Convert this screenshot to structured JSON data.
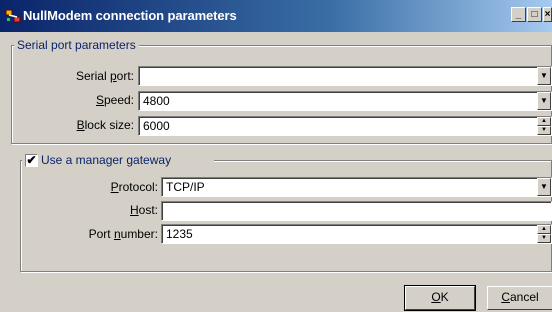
{
  "window": {
    "title": "NullModem connection parameters",
    "controls": {
      "minimize": "_",
      "maximize": "□",
      "close": "×"
    }
  },
  "serial_group": {
    "legend": "Serial port parameters",
    "serial_port": {
      "label_prefix": "Serial ",
      "label_accel": "p",
      "label_suffix": "ort:",
      "value": ""
    },
    "speed": {
      "label_prefix": "",
      "label_accel": "S",
      "label_suffix": "peed:",
      "value": "4800"
    },
    "block_size": {
      "label_prefix": "",
      "label_accel": "B",
      "label_suffix": "lock size:",
      "value": "6000"
    }
  },
  "gateway_group": {
    "checkbox_label": "Use a manager gateway",
    "checked": true,
    "protocol": {
      "label_prefix": "",
      "label_accel": "P",
      "label_suffix": "rotocol:",
      "value": "TCP/IP"
    },
    "host": {
      "label_prefix": "",
      "label_accel": "H",
      "label_suffix": "ost:",
      "value": ""
    },
    "port_number": {
      "label_prefix": "Port ",
      "label_accel": "n",
      "label_suffix": "umber:",
      "value": "1235"
    }
  },
  "buttons": {
    "ok": {
      "accel": "O",
      "rest": "K"
    },
    "cancel": {
      "accel": "C",
      "rest": "ancel"
    }
  },
  "icons": {
    "title": "connection-icon",
    "dropdown": "chevron-down-icon",
    "spin_up": "arrow-up-icon",
    "spin_down": "arrow-down-icon",
    "check": "checkmark-icon"
  }
}
